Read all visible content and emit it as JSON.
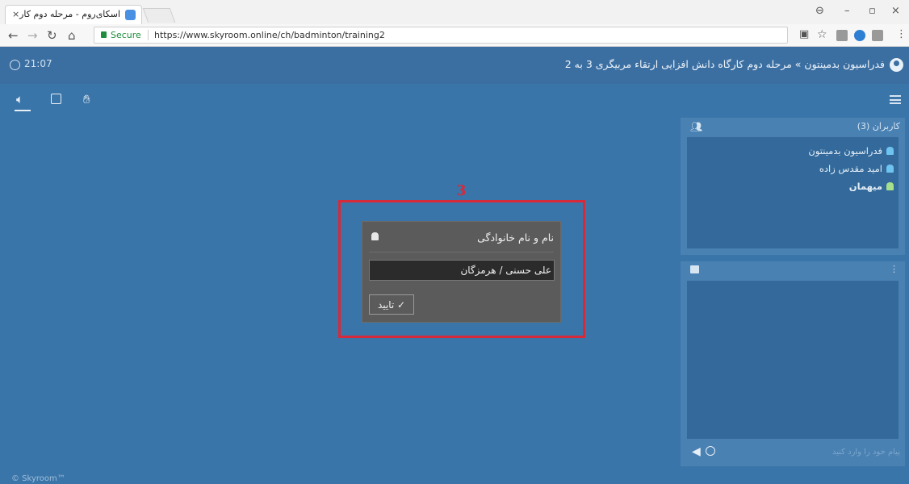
{
  "browser": {
    "tab_title": "اسکای‌روم - مرحله دوم کار",
    "tab_close": "×",
    "secure_label": "Secure",
    "url": "https://www.skyroom.online/ch/badminton/training2",
    "win_minimize": "–",
    "win_maximize": "▫",
    "win_close": "×"
  },
  "header": {
    "time": "21:07",
    "room_title": "فدراسیون بدمینتون » مرحله دوم کارگاه دانش افزایی ارتقاء مربیگری 3 به 2"
  },
  "users_panel": {
    "title": "کاربران (3)",
    "users": [
      {
        "name": "فدراسیون بدمینتون"
      },
      {
        "name": "امید مقدس زاده"
      },
      {
        "name": "میهمان"
      }
    ]
  },
  "chat_panel": {
    "input_placeholder": "پیام خود را وارد کنید"
  },
  "dialog": {
    "step_number": "3",
    "title": "نام و نام خانوادگی",
    "input_value": "علی حسنی / هرمزگان",
    "confirm_label": "✓ تایید"
  },
  "footer": "© Skyroom™"
}
